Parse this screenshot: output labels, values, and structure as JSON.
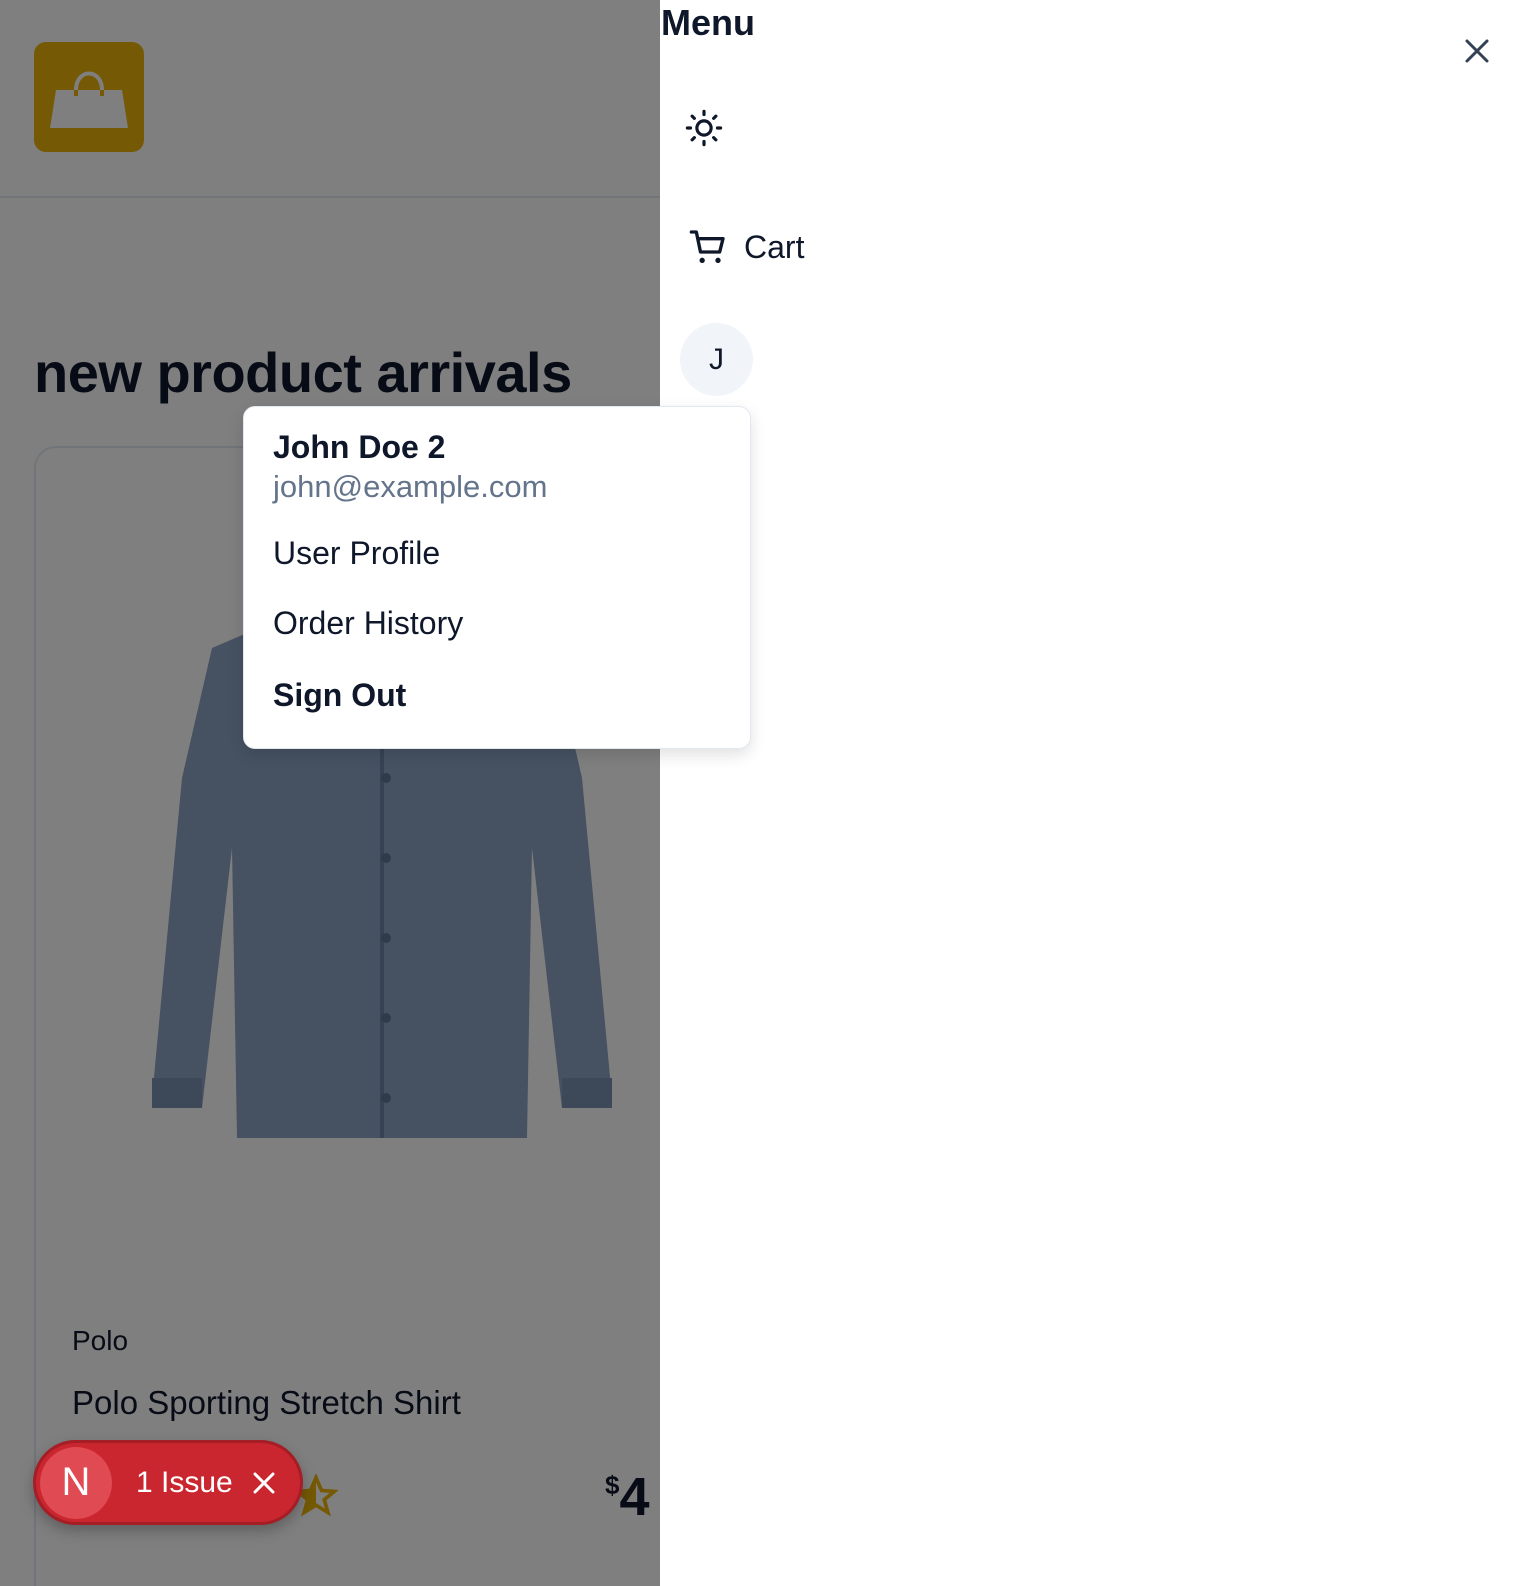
{
  "store": {
    "logo_icon": "shopping-bag-icon",
    "brand_color": "#eab308"
  },
  "main": {
    "section_title": "new product arrivals",
    "product": {
      "brand": "Polo",
      "name": "Polo Sporting Stretch Shirt",
      "price_currency": "$",
      "price_visible": "4",
      "image_icon": "shirt-image"
    }
  },
  "drawer": {
    "title": "Menu",
    "close_icon": "close-icon",
    "theme_icon": "theme-toggle-icon",
    "cart_label": "Cart",
    "avatar_initial": "J"
  },
  "user_menu": {
    "name": "John Doe 2",
    "email": "john@example.com",
    "items": [
      "User Profile",
      "Order History",
      "Sign Out"
    ]
  },
  "issue_badge": {
    "letter": "N",
    "label": "1 Issue",
    "color": "#c9262f"
  }
}
